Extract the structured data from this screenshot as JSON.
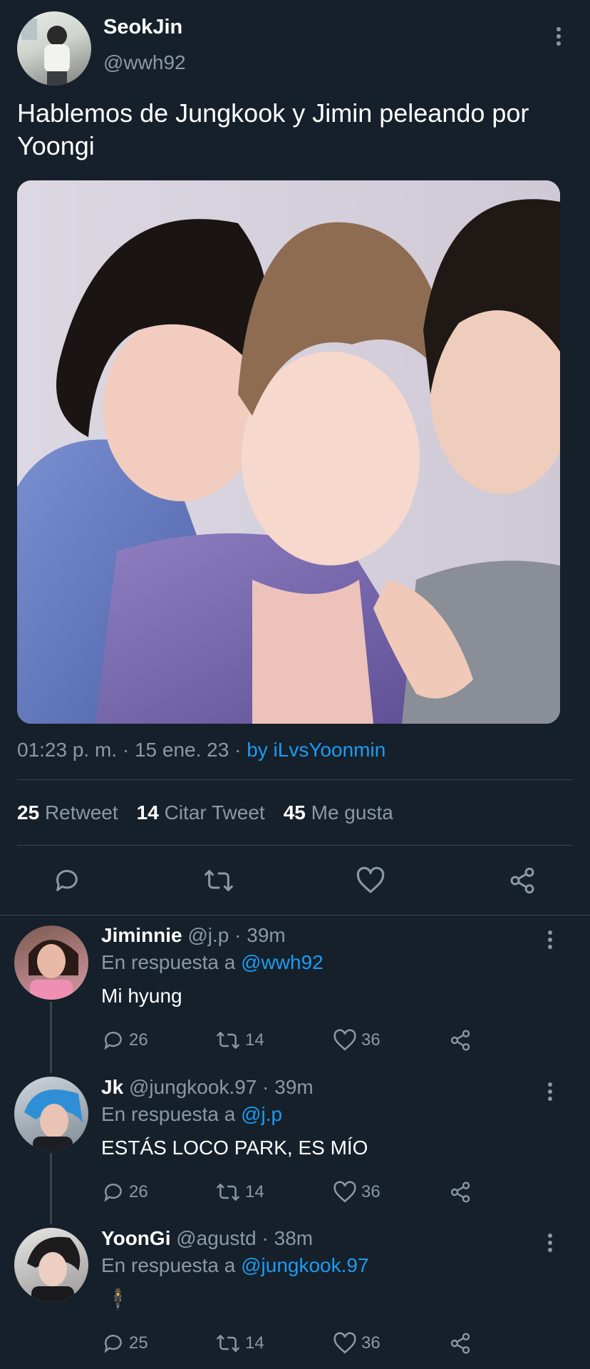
{
  "tweet": {
    "author_name": "SeokJin",
    "author_handle": "@wwh92",
    "text": "Hablemos de Jungkook y Jimin peleando por Yoongi",
    "time": "01:23 p. m. · 15 ene. 23 · ",
    "source": "by iLvsYoonmin"
  },
  "stats": {
    "retweets": "25",
    "retweets_label": "Retweet",
    "quotes": "14",
    "quotes_label": "Citar Tweet",
    "likes": "45",
    "likes_label": "Me gusta"
  },
  "replies": [
    {
      "name": "Jiminnie",
      "handle": "@j.p",
      "time": "· 39m",
      "reply_prefix": "En respuesta a",
      "reply_to": "@wwh92",
      "text": "Mi hyung",
      "comments": "26",
      "retweets": "14",
      "likes": "36"
    },
    {
      "name": "Jk",
      "handle": "@jungkook.97",
      "time": "· 39m",
      "reply_prefix": "En respuesta a",
      "reply_to": "@j.p",
      "text": "ESTÁS LOCO PARK, ES MÍO",
      "comments": "26",
      "retweets": "14",
      "likes": "36"
    },
    {
      "name": "YoonGi",
      "handle": "@agustd",
      "time": "· 38m",
      "reply_prefix": "En respuesta a",
      "reply_to": "@jungkook.97",
      "text": "🕴",
      "comments": "25",
      "retweets": "14",
      "likes": "36"
    }
  ],
  "colors": {
    "background": "#15202b",
    "accent": "#1d9bf0",
    "muted": "#8b98a5",
    "divider": "#38444d"
  }
}
